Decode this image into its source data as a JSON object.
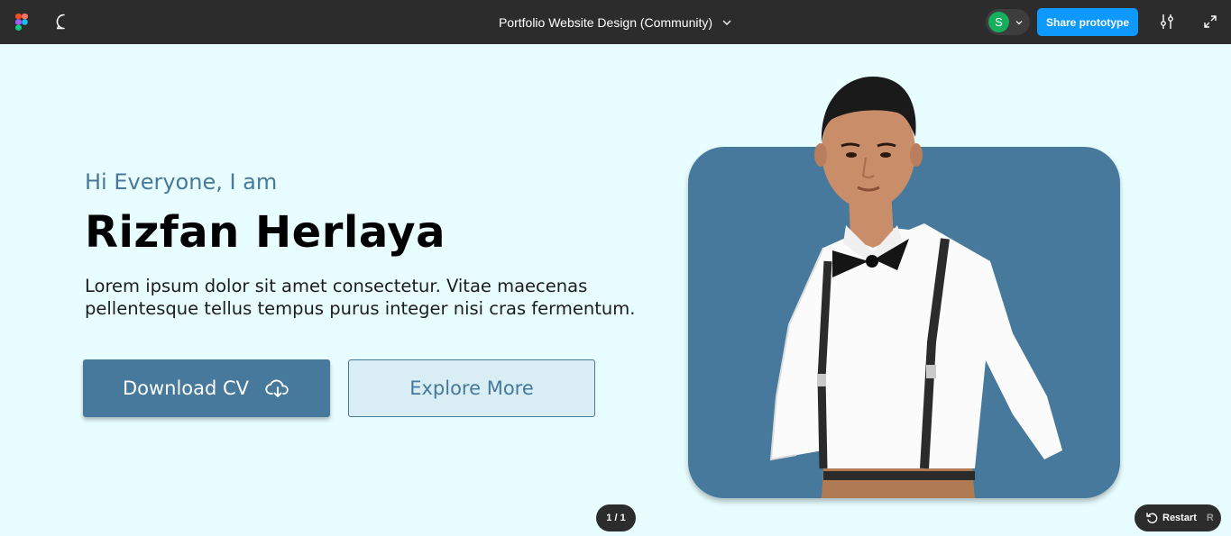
{
  "toolbar": {
    "app_icon": "figma-logo-icon",
    "comment_icon": "comment-icon",
    "document_title": "Portfolio Website Design (Community)",
    "avatar_initial": "S",
    "avatar_color": "#14ae5c",
    "share_label": "Share prototype",
    "share_color": "#0d99ff",
    "settings_icon": "sliders-icon",
    "expand_icon": "expand-icon"
  },
  "hero": {
    "greeting": "Hi Everyone, I am",
    "name": "Rizfan Herlaya",
    "description": "Lorem ipsum dolor sit amet consectetur. Vitae maecenas pellentesque tellus tempus purus integer nisi cras fermentum.",
    "primary_button": "Download CV",
    "primary_icon": "cloud-download-icon",
    "secondary_button": "Explore More",
    "accent_color": "#46799b",
    "background_color": "#e8fdff"
  },
  "footer": {
    "page_indicator": "1 / 1",
    "restart_label": "Restart",
    "restart_shortcut": "R"
  }
}
